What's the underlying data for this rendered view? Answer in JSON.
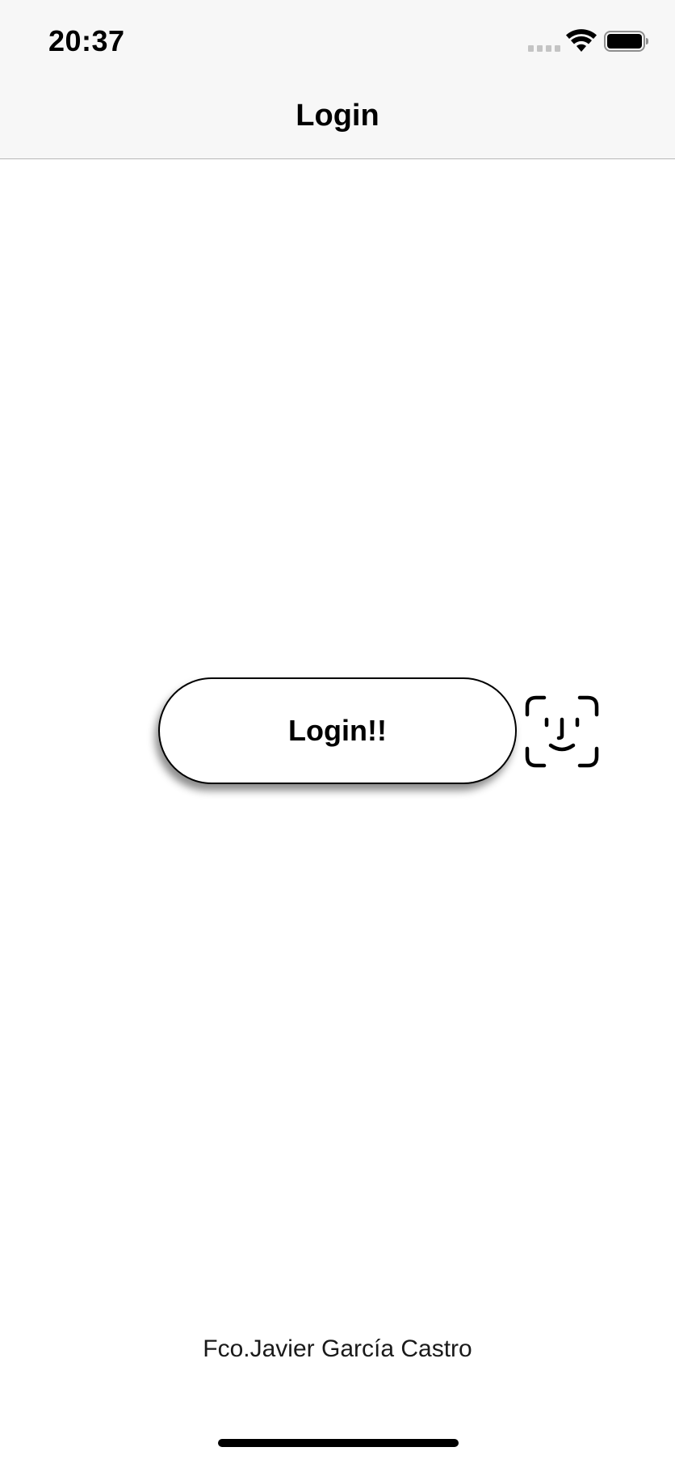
{
  "status_bar": {
    "time": "20:37",
    "icons": [
      "cellular-signal-icon",
      "wifi-icon",
      "battery-icon"
    ]
  },
  "nav_bar": {
    "title": "Login"
  },
  "main": {
    "login_button_label": "Login!!",
    "faceid_icon": "face-id-icon"
  },
  "footer": {
    "author": "Fco.Javier García Castro"
  },
  "colors": {
    "bar_background": "#f7f7f7",
    "background": "#ffffff",
    "foreground": "#000000"
  }
}
